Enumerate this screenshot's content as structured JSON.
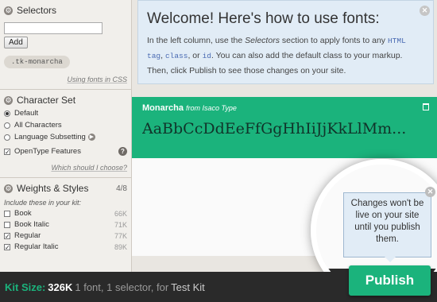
{
  "selectors": {
    "title": "Selectors",
    "input_value": "",
    "add_label": "Add",
    "selector_tag": ".tk-monarcha",
    "help_link": "Using fonts in CSS"
  },
  "charset": {
    "title": "Character Set",
    "options": [
      {
        "label": "Default",
        "selected": true
      },
      {
        "label": "All Characters",
        "selected": false
      },
      {
        "label": "Language Subsetting",
        "selected": false
      }
    ],
    "opentype_label": "OpenType Features",
    "opentype_checked": true,
    "help_link": "Which should I choose?"
  },
  "weights": {
    "title": "Weights & Styles",
    "count": "4/8",
    "subheading": "Include these in your kit:",
    "items": [
      {
        "label": "Book",
        "size": "66K",
        "checked": false
      },
      {
        "label": "Book Italic",
        "size": "71K",
        "checked": false
      },
      {
        "label": "Regular",
        "size": "77K",
        "checked": true
      },
      {
        "label": "Regular Italic",
        "size": "89K",
        "checked": true
      }
    ]
  },
  "welcome": {
    "title": "Welcome! Here's how to use fonts:",
    "p1": "In the left column, use the",
    "p_selectors": "Selectors",
    "p2": "section to apply fonts to any",
    "code_html": "HTML tag",
    "p3": ",",
    "code_class": "class",
    "p4": ", or",
    "code_id": "id",
    "p5": ". You can also add the default class to your markup. Then, click Publish to see those changes on your site."
  },
  "font": {
    "name": "Monarcha",
    "foundry": "from Isaco Type",
    "sample": "AaBbCcDdEeFfGgHhIiJjKkLlMm..."
  },
  "tooltip": {
    "text": "Changes won't be live on your site until you publish them."
  },
  "footer": {
    "kit_size_label": "Kit Size:",
    "kit_size_value": "326K",
    "summary": "1 font, 1 selector, for",
    "kit_name": "Test Kit",
    "publish_label": "Publish"
  },
  "colors": {
    "accent_green": "#1bb37c",
    "welcome_bg": "#e1ecf6",
    "bar_bg": "#2a2a2a"
  }
}
